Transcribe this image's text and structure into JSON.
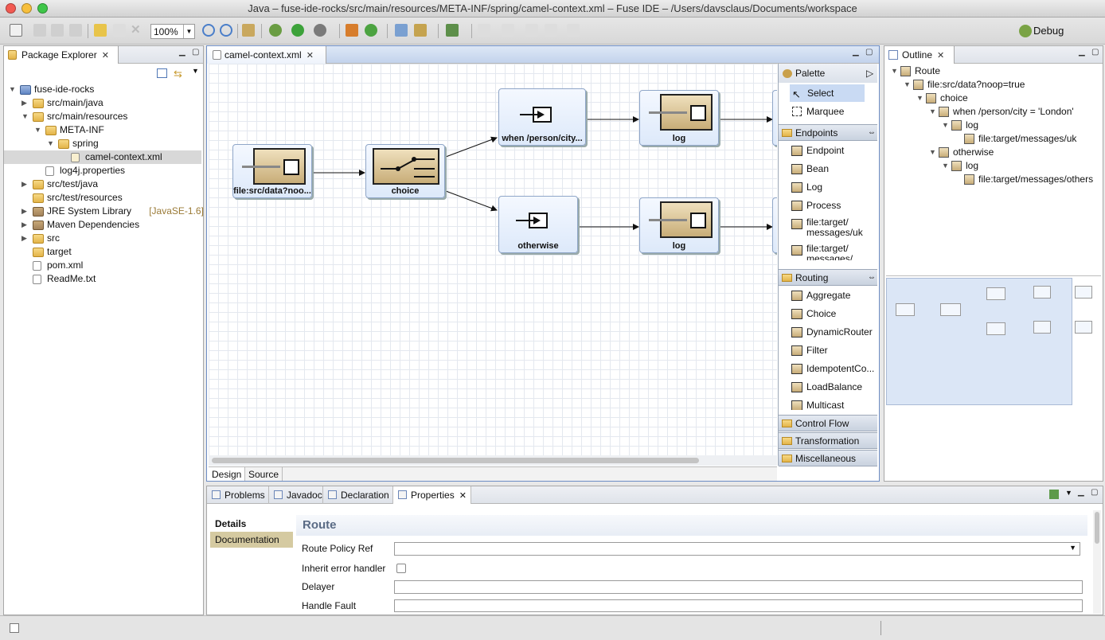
{
  "window": {
    "title": "Java – fuse-ide-rocks/src/main/resources/META-INF/spring/camel-context.xml – Fuse IDE – /Users/davsclaus/Documents/workspace"
  },
  "toolbar": {
    "zoom": "100%",
    "debug_label": "Debug"
  },
  "package_explorer": {
    "tab": "Package Explorer",
    "items": [
      {
        "label": "fuse-ide-rocks",
        "type": "project",
        "indent": 0,
        "twisty": "open"
      },
      {
        "label": "src/main/java",
        "type": "pkgfolder",
        "indent": 1,
        "twisty": "closed"
      },
      {
        "label": "src/main/resources",
        "type": "pkgfolder",
        "indent": 1,
        "twisty": "open"
      },
      {
        "label": "META-INF",
        "type": "folder",
        "indent": 2,
        "twisty": "open"
      },
      {
        "label": "spring",
        "type": "folder",
        "indent": 3,
        "twisty": "open"
      },
      {
        "label": "camel-context.xml",
        "type": "xml",
        "indent": 4,
        "twisty": "",
        "selected": true
      },
      {
        "label": "log4j.properties",
        "type": "file",
        "indent": 2,
        "twisty": ""
      },
      {
        "label": "src/test/java",
        "type": "pkgfolder",
        "indent": 1,
        "twisty": "closed"
      },
      {
        "label": "src/test/resources",
        "type": "pkgfolder",
        "indent": 1,
        "twisty": ""
      },
      {
        "label": "JRE System Library",
        "suffix": "[JavaSE-1.6]",
        "type": "jar",
        "indent": 1,
        "twisty": "closed"
      },
      {
        "label": "Maven Dependencies",
        "type": "jar",
        "indent": 1,
        "twisty": "closed"
      },
      {
        "label": "src",
        "type": "folder",
        "indent": 1,
        "twisty": "closed"
      },
      {
        "label": "target",
        "type": "folder",
        "indent": 1,
        "twisty": ""
      },
      {
        "label": "pom.xml",
        "type": "file",
        "indent": 1,
        "twisty": ""
      },
      {
        "label": "ReadMe.txt",
        "type": "file",
        "indent": 1,
        "twisty": ""
      }
    ]
  },
  "editor": {
    "tab": "camel-context.xml",
    "bottom_tabs": [
      "Design",
      "Source"
    ],
    "nodes": {
      "from": "file:src/data?noo...",
      "choice": "choice",
      "when": "when /person/city...",
      "log1": "log",
      "otherwise": "otherwise",
      "log2": "log"
    }
  },
  "palette": {
    "title": "Palette",
    "tools": [
      "Select",
      "Marquee"
    ],
    "endpoints": {
      "title": "Endpoints",
      "items": [
        "Endpoint",
        "Bean",
        "Log",
        "Process",
        "file:target/ messages/uk",
        "file:target/ messages/"
      ]
    },
    "routing": {
      "title": "Routing",
      "items": [
        "Aggregate",
        "Choice",
        "DynamicRouter",
        "Filter",
        "IdempotentCo...",
        "LoadBalance",
        "Multicast"
      ]
    },
    "drawers": [
      "Control Flow",
      "Transformation",
      "Miscellaneous"
    ]
  },
  "outline": {
    "tab": "Outline",
    "items": [
      {
        "label": "Route",
        "indent": 0,
        "twisty": "open"
      },
      {
        "label": "file:src/data?noop=true",
        "indent": 1,
        "twisty": "open"
      },
      {
        "label": "choice",
        "indent": 2,
        "twisty": "open"
      },
      {
        "label": "when /person/city = 'London'",
        "indent": 3,
        "twisty": "open"
      },
      {
        "label": "log",
        "indent": 4,
        "twisty": "open"
      },
      {
        "label": "file:target/messages/uk",
        "indent": 5,
        "twisty": ""
      },
      {
        "label": "otherwise",
        "indent": 3,
        "twisty": "open"
      },
      {
        "label": "log",
        "indent": 4,
        "twisty": "open"
      },
      {
        "label": "file:target/messages/others",
        "indent": 5,
        "twisty": ""
      }
    ]
  },
  "bottom": {
    "tabs": [
      "Problems",
      "Javadoc",
      "Declaration",
      "Properties"
    ],
    "side_tabs": [
      "Details",
      "Documentation"
    ],
    "section_title": "Route",
    "fields": {
      "policy": "Route Policy Ref",
      "inherit": "Inherit error handler",
      "delayer": "Delayer",
      "handle_fault": "Handle Fault"
    }
  }
}
